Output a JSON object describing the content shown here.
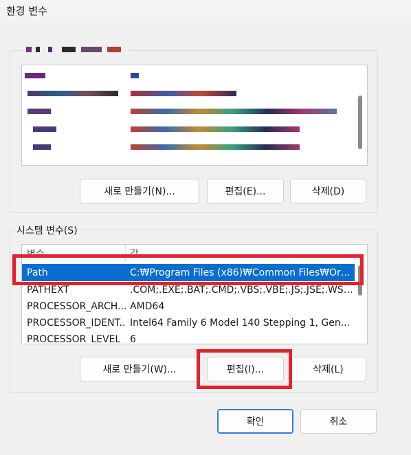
{
  "window": {
    "title": "환경 변수"
  },
  "user_vars": {
    "buttons": {
      "new": "새로 만들기(N)...",
      "edit": "편집(E)...",
      "delete": "삭제(D)"
    }
  },
  "system_vars": {
    "label": "시스템 변수(S)",
    "columns": {
      "name": "변수",
      "value": "값"
    },
    "rows": [
      {
        "name": "Path",
        "value": "C:₩Program Files (x86)₩Common Files₩Orac...",
        "selected": true
      },
      {
        "name": "PATHEXT",
        "value": ".COM;.EXE;.BAT;.CMD;.VBS;.VBE;.JS;.JSE;.WSF;...",
        "selected": false
      },
      {
        "name": "PROCESSOR_ARCH...",
        "value": "AMD64",
        "selected": false
      },
      {
        "name": "PROCESSOR_IDENT...",
        "value": "Intel64 Family 6 Model 140 Stepping 1, Gen...",
        "selected": false
      },
      {
        "name": "PROCESSOR_LEVEL",
        "value": "6",
        "selected": false
      }
    ],
    "buttons": {
      "new": "새로 만들기(W)...",
      "edit": "편집(I)...",
      "delete": "삭제(L)"
    }
  },
  "footer": {
    "ok": "확인",
    "cancel": "취소"
  },
  "colors": {
    "selection": "#0a6ed1",
    "highlight_box": "#e4222b",
    "default_button_border": "#3a7ccf"
  }
}
